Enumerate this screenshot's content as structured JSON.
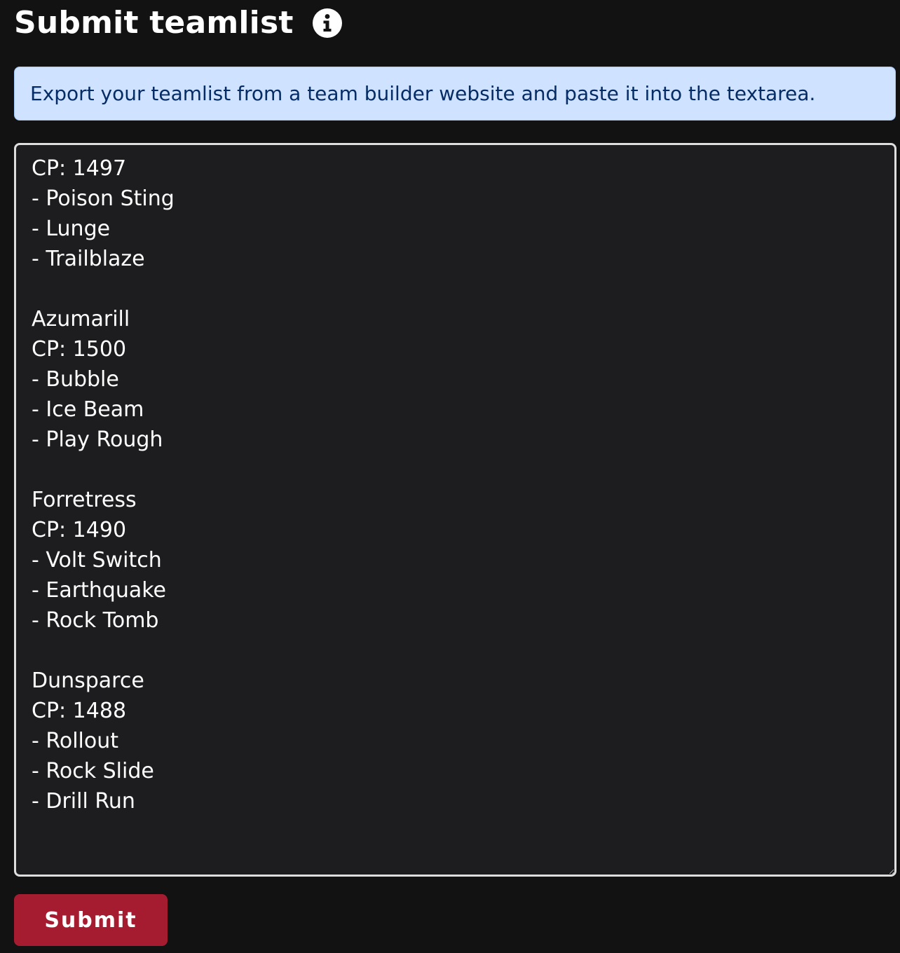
{
  "header": {
    "title": "Submit teamlist",
    "info_icon": "info-circle-icon"
  },
  "alert": {
    "message": "Export your teamlist from a team builder website and paste it into the textarea."
  },
  "teamlist": {
    "value": "CP: 1497\n- Poison Sting\n- Lunge\n- Trailblaze\n\nAzumarill\nCP: 1500\n- Bubble\n- Ice Beam\n- Play Rough\n\nForretress\nCP: 1490\n- Volt Switch\n- Earthquake\n- Rock Tomb\n\nDunsparce\nCP: 1488\n- Rollout\n- Rock Slide\n- Drill Run"
  },
  "actions": {
    "submit_label": "Submit"
  },
  "colors": {
    "background": "#121212",
    "alert_bg": "#cfe2ff",
    "alert_text": "#052c65",
    "submit_bg": "#a51c30"
  }
}
